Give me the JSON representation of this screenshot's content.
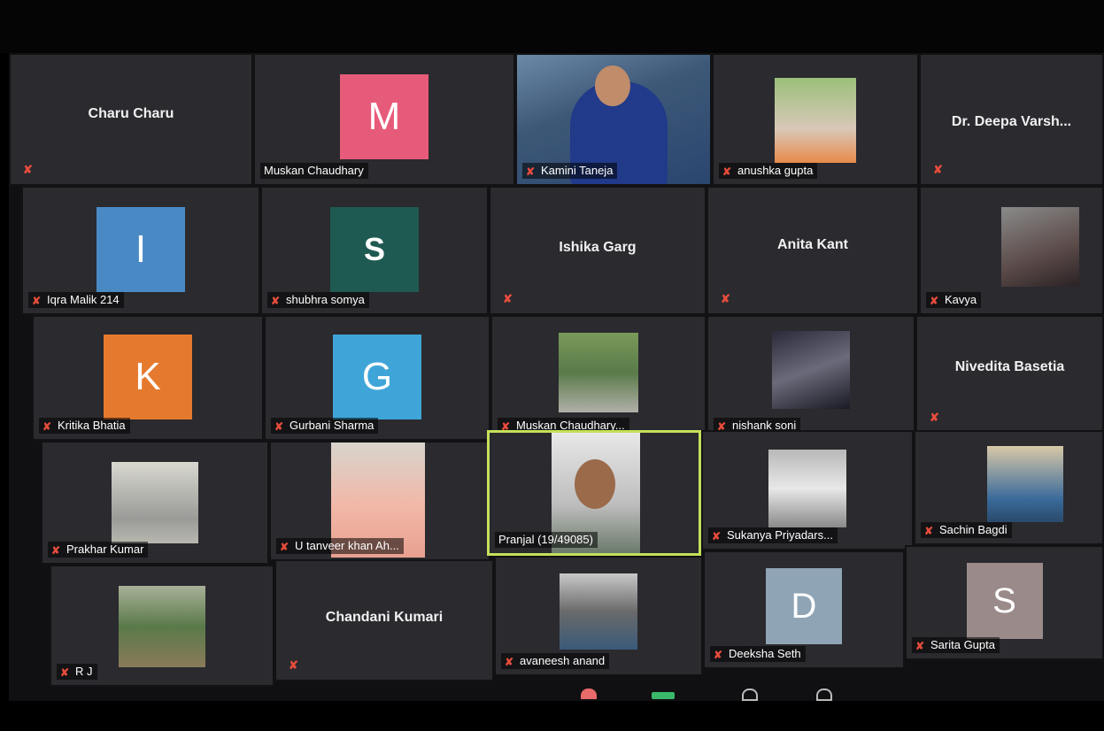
{
  "participants": [
    {
      "name": "Charu Charu",
      "type": "name",
      "muted": true
    },
    {
      "name": "Muskan Chaudhary",
      "type": "avatar",
      "letter": "M",
      "color": "#e75b7a",
      "muted": false
    },
    {
      "name": "Kamini Taneja",
      "type": "video",
      "muted": true
    },
    {
      "name": "anushka gupta",
      "type": "photo",
      "muted": true
    },
    {
      "name": "Dr. Deepa Varsh...",
      "type": "name",
      "muted": true
    },
    {
      "name": "Iqra Malik 214",
      "type": "avatar",
      "letter": "I",
      "color": "#4a8ac4",
      "muted": true
    },
    {
      "name": "shubhra somya",
      "type": "avatar",
      "letter": "S",
      "color": "#1f5a52",
      "muted": true
    },
    {
      "name": "Ishika Garg",
      "type": "name",
      "muted": true
    },
    {
      "name": "Anita Kant",
      "type": "name",
      "muted": true
    },
    {
      "name": "Kavya",
      "type": "photo",
      "muted": true
    },
    {
      "name": "Kritika Bhatia",
      "type": "avatar",
      "letter": "K",
      "color": "#e57a2e",
      "muted": true
    },
    {
      "name": "Gurbani Sharma",
      "type": "avatar",
      "letter": "G",
      "color": "#3fa5d8",
      "muted": true
    },
    {
      "name": "Muskan Chaudhary...",
      "type": "photo",
      "muted": true
    },
    {
      "name": "nishank soni",
      "type": "photo",
      "muted": true
    },
    {
      "name": "Nivedita Basetia",
      "type": "name",
      "muted": true
    },
    {
      "name": "Prakhar Kumar",
      "type": "photo",
      "muted": true
    },
    {
      "name": "U tanveer khan Ah...",
      "type": "video",
      "muted": true
    },
    {
      "name": "Pranjal (19/49085)",
      "type": "video",
      "muted": false,
      "active": true
    },
    {
      "name": "Sukanya Priyadars...",
      "type": "photo",
      "muted": true
    },
    {
      "name": "Sachin Bagdi",
      "type": "photo",
      "muted": true
    },
    {
      "name": "R J",
      "type": "photo",
      "muted": true
    },
    {
      "name": "Chandani Kumari",
      "type": "name",
      "muted": true
    },
    {
      "name": "avaneesh anand",
      "type": "photo",
      "muted": true
    },
    {
      "name": "Deeksha Seth",
      "type": "avatar",
      "letter": "D",
      "color": "#8fa4b4",
      "muted": true
    },
    {
      "name": "Sarita Gupta",
      "type": "avatar",
      "letter": "S",
      "color": "#9b8a8a",
      "muted": true
    }
  ],
  "icons": {
    "muted": "mic-muted-icon"
  },
  "colors": {
    "muted": "#e74c3c",
    "active_border": "#c5e05a",
    "tile_bg": "#2a2a2f"
  }
}
